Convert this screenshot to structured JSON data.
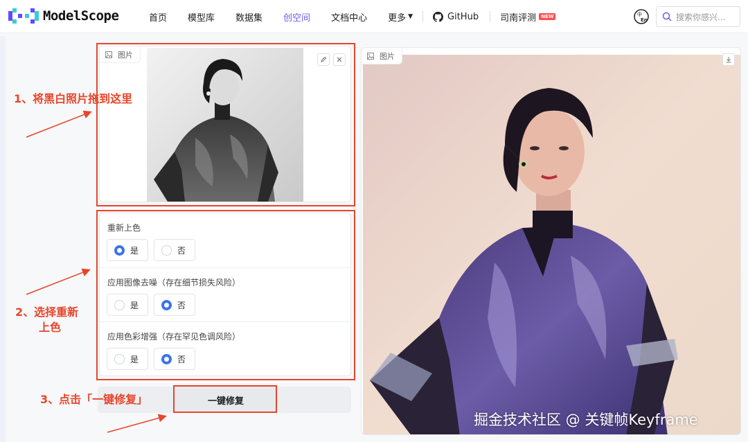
{
  "nav": {
    "logo_text": "ModelScope",
    "items": [
      {
        "label": "首页"
      },
      {
        "label": "模型库"
      },
      {
        "label": "数据集"
      },
      {
        "label": "创空间"
      },
      {
        "label": "文档中心"
      },
      {
        "label": "更多"
      }
    ],
    "github_label": "GitHub",
    "eval_label": "司南评测",
    "new_badge": "NEW",
    "search_placeholder": "搜索你感兴..."
  },
  "input_panel": {
    "label": "图片",
    "icon": "image-icon",
    "tools": [
      "edit-icon",
      "close-icon"
    ]
  },
  "options": [
    {
      "title": "重新上色",
      "choices": [
        "是",
        "否"
      ],
      "selected": "是"
    },
    {
      "title": "应用图像去噪（存在细节损失风险）",
      "choices": [
        "是",
        "否"
      ],
      "selected": "否"
    },
    {
      "title": "应用色彩增强（存在罕见色调风险）",
      "choices": [
        "是",
        "否"
      ],
      "selected": "否"
    }
  ],
  "run_button": "一键修复",
  "output_panel": {
    "label": "图片",
    "tools": [
      "download-icon"
    ]
  },
  "annotations": {
    "step1": "1、将黑白照片拖到这里",
    "step2_line1": "2、选择重新",
    "step2_line2": "上色",
    "step3": "3、点击「一键修复」"
  },
  "watermark": "掘金技术社区 @ 关键帧Keyframe",
  "colors": {
    "accent": "#6a5cf0",
    "radio_on": "#3b74e8",
    "annotation": "#e8452a"
  }
}
